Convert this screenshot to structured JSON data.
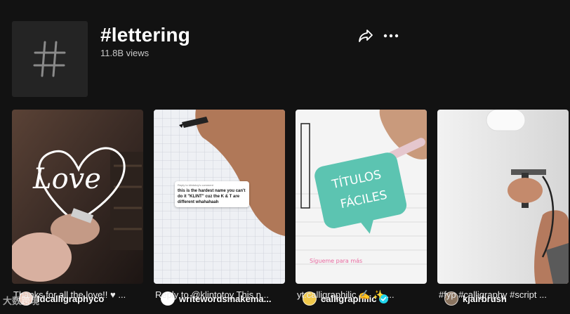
{
  "hashtag": {
    "title": "#lettering",
    "views": "11.8B views",
    "tile_icon": "hashtag-icon"
  },
  "actions": {
    "share_icon": "share-icon",
    "more_icon": "more-icon"
  },
  "videos": [
    {
      "author": "ldcalligraphyco",
      "caption": "Thanks for all the love!! ♥ ...",
      "thumbnail_text": "Love",
      "verified": false
    },
    {
      "author": "writewordsmakema...",
      "caption": "Reply to @klintotoy This n...",
      "thumbnail_text": "this is the hardest name you can't do it \"KLINT\" cuz the K & T are different whahahaah",
      "thumbnail_header": "Reply to klintotoy's comment",
      "verified": false
    },
    {
      "author": "calligraphilic",
      "caption": "yt:calligraphilic ✍ ✨ ...",
      "thumbnail_text": "TÍTULOS FÁCILES",
      "thumbnail_subtext": "Sígueme para más",
      "verified": true
    },
    {
      "author": "kjairbrush",
      "caption": "#fyp #calligraphy #script ...",
      "verified": false
    }
  ],
  "watermark": "大数跨境",
  "colors": {
    "background": "#121212",
    "tile": "#242424",
    "verified": "#20d5ec",
    "teal_sign": "#5cc4b1"
  }
}
